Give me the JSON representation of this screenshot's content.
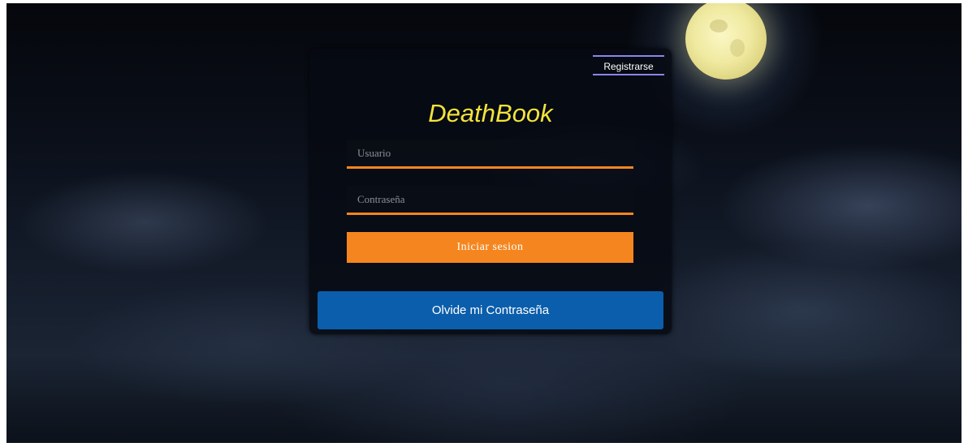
{
  "app": {
    "brand_title": "DeathBook",
    "brand_color": "#f3e43a"
  },
  "header": {
    "register_label": "Registrarse"
  },
  "login_form": {
    "username_placeholder": "Usuario",
    "password_placeholder": "Contraseña",
    "submit_label": "Iniciar sesion",
    "forgot_label": "Olvide mi Contraseña"
  },
  "colors": {
    "accent": "#f5861f",
    "forgot_button": "#0b5eab",
    "register_border": "#8a86e8",
    "moon": "#efe9a0"
  },
  "icons": {
    "background": "night-sky-moon-clouds"
  }
}
